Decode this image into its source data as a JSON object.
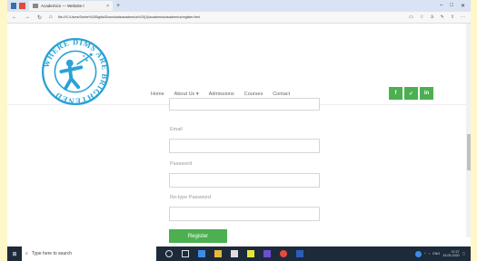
{
  "browser": {
    "tab_title": "Academics — Website t",
    "tab_close": "×",
    "new_tab": "+",
    "url": "file:///C:/Users/Grebe%20Digital/Downloads/academics%20(1)/academics/academics/register.html",
    "back": "←",
    "forward": "→",
    "refresh": "↻",
    "home": "⌂",
    "window_controls": {
      "minimize": "–",
      "maximize": "□",
      "close": "✕"
    }
  },
  "site": {
    "logo_text": "WHERE DIMS ARE BRIGHTENED",
    "nav": [
      "Home",
      "About Us ▾",
      "Admissions",
      "Courses",
      "Contact"
    ],
    "social": [
      "f",
      "✓",
      "in"
    ]
  },
  "form": {
    "email_label": "Email",
    "password_label": "Password",
    "retype_label": "Re-type Password",
    "email_value": "",
    "password_value": "",
    "retype_value": "",
    "register_label": "Register"
  },
  "taskbar": {
    "search_placeholder": "Type here to search",
    "time": "07:27",
    "date": "15-05-2020",
    "lang": "ENG"
  },
  "colors": {
    "accent_green": "#4caf50",
    "logo_blue": "#2aa2d6",
    "taskbar": "#1d2a3a"
  }
}
